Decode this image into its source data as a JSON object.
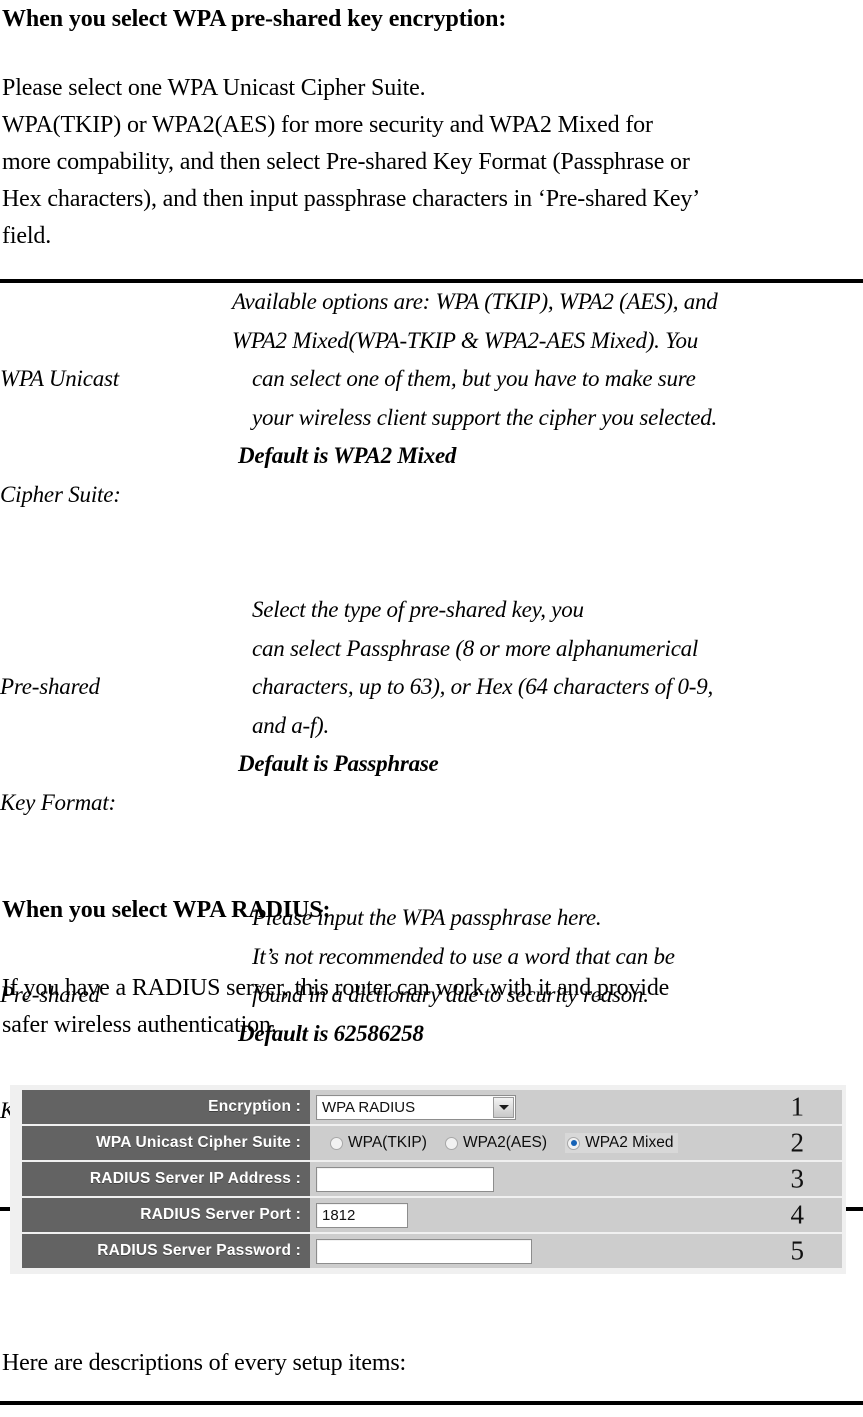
{
  "section_psk": {
    "heading": "When you select WPA pre-shared key encryption:",
    "paragraph_lines": [
      "Please select one WPA Unicast Cipher Suite.",
      "WPA(TKIP) or WPA2(AES) for more security and WPA2 Mixed for",
      "more compability, and then select Pre-shared Key Format (Passphrase or",
      "Hex characters), and then input passphrase characters in ‘Pre-shared Key’",
      "field."
    ],
    "table": {
      "rows": [
        {
          "term_lines": [
            "WPA Unicast",
            "Cipher Suite:"
          ],
          "def_lines": [
            {
              "text": "Available options are: WPA (TKIP), WPA2 (AES), and",
              "style": "flush"
            },
            {
              "text": "WPA2 Mixed(WPA-TKIP & WPA2-AES Mixed). You",
              "style": "flush"
            },
            {
              "text": "can select one of them, but you have to make sure",
              "style": "indent"
            },
            {
              "text": "your wireless client support the cipher you selected.",
              "style": "indent"
            },
            {
              "text": "Default is WPA2 Mixed",
              "style": "default"
            }
          ]
        },
        {
          "term_lines": [
            "Pre-shared",
            "Key Format:"
          ],
          "def_lines": [
            {
              "text": "Select the type of pre-shared key, you",
              "style": "flush"
            },
            {
              "text": "can select Passphrase (8 or more alphanumerical",
              "style": "flush"
            },
            {
              "text": "characters, up to 63), or Hex (64 characters of 0-9,",
              "style": "flush"
            },
            {
              "text": "and a-f).",
              "style": "flush"
            },
            {
              "text": "Default is Passphrase",
              "style": "default"
            }
          ]
        },
        {
          "term_lines": [
            "Pre-shared",
            "Key:"
          ],
          "def_lines": [
            {
              "text": "Please input the WPA passphrase here.",
              "style": "flush"
            },
            {
              "text": "It’s not recommended to use a word that can be",
              "style": "flush"
            },
            {
              "text": "found in a dictionary due to security reason.",
              "style": "flush"
            },
            {
              "text": "Default is 62586258",
              "style": "default"
            }
          ]
        }
      ]
    }
  },
  "section_radius": {
    "heading": "When you select WPA RADIUS:",
    "paragraph_lines": [
      "If you have a RADIUS server, this router can work with it and provide",
      "safer wireless authentication."
    ],
    "closing_line": "Here are descriptions of every setup items:"
  },
  "router_ui": {
    "rows": [
      {
        "label": "Encryption :",
        "control": "select",
        "value": "WPA RADIUS",
        "callout": "1"
      },
      {
        "label": "WPA Unicast Cipher Suite :",
        "control": "radios",
        "options": [
          {
            "label": "WPA(TKIP)",
            "checked": false
          },
          {
            "label": "WPA2(AES)",
            "checked": false
          },
          {
            "label": "WPA2 Mixed",
            "checked": true
          }
        ],
        "callout": "2"
      },
      {
        "label": "RADIUS Server IP Address :",
        "control": "text",
        "value": "",
        "callout": "3"
      },
      {
        "label": "RADIUS Server Port :",
        "control": "text",
        "value": "1812",
        "callout": "4"
      },
      {
        "label": "RADIUS Server Password :",
        "control": "text",
        "value": "",
        "callout": "5"
      }
    ]
  },
  "colors": {
    "label_bg": "#636363",
    "value_bg": "#cdcdcd",
    "panel_bg": "#f0f0f0",
    "radio_accent": "#1763b6"
  }
}
